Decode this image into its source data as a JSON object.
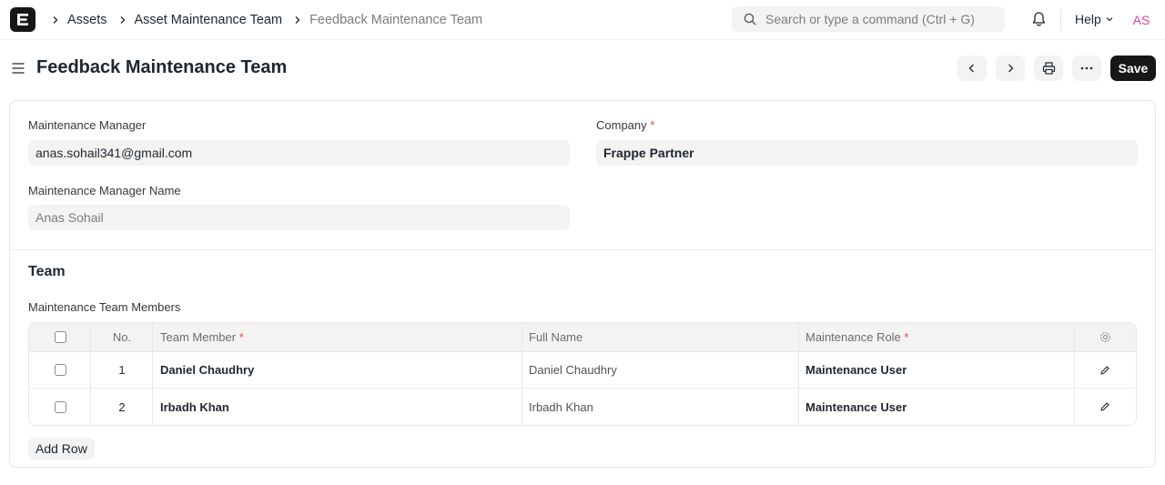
{
  "navbar": {
    "breadcrumbs": [
      "Assets",
      "Asset Maintenance Team"
    ],
    "current": "Feedback Maintenance Team",
    "search_placeholder": "Search or type a command (Ctrl + G)",
    "help_label": "Help",
    "avatar_initials": "AS"
  },
  "page": {
    "title": "Feedback Maintenance Team",
    "save_label": "Save"
  },
  "form": {
    "maintenance_manager_label": "Maintenance Manager",
    "maintenance_manager_value": "anas.sohail341@gmail.com",
    "company_label": "Company",
    "company_value": "Frappe Partner",
    "manager_name_label": "Maintenance Manager Name",
    "manager_name_value": "Anas Sohail",
    "required_mark": "*"
  },
  "team": {
    "section_title": "Team",
    "table_label": "Maintenance Team Members",
    "columns": {
      "no": "No.",
      "team_member": "Team Member",
      "full_name": "Full Name",
      "maintenance_role": "Maintenance Role"
    },
    "rows": [
      {
        "no": "1",
        "team_member": "Daniel Chaudhry",
        "full_name": "Daniel Chaudhry",
        "role": "Maintenance User"
      },
      {
        "no": "2",
        "team_member": "Irbadh Khan",
        "full_name": "Irbadh Khan",
        "role": "Maintenance User"
      }
    ],
    "add_row_label": "Add Row"
  },
  "colors": {
    "primary_button": "#171717",
    "required": "#e24c4c",
    "avatar_text": "#e0449c"
  }
}
